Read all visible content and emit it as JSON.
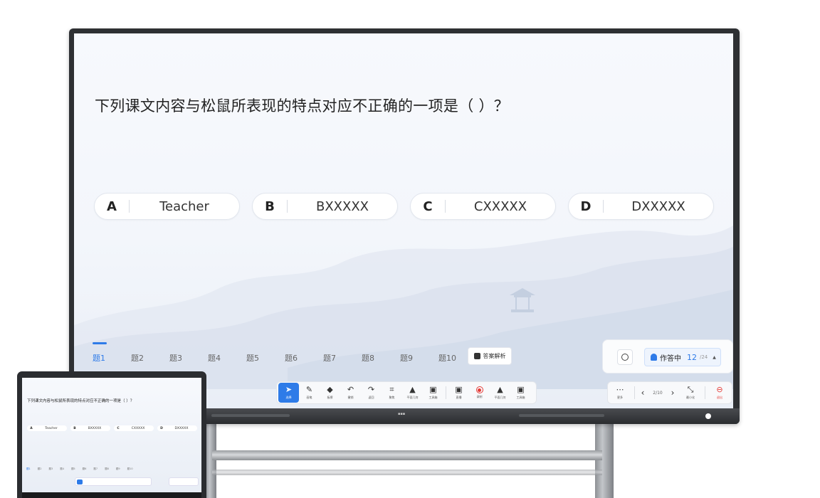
{
  "question": {
    "text": "下列课文内容与松鼠所表现的特点对应不正确的一项是（ ）？"
  },
  "options": [
    {
      "letter": "A",
      "text": "Teacher"
    },
    {
      "letter": "B",
      "text": "BXXXXX"
    },
    {
      "letter": "C",
      "text": "CXXXXX"
    },
    {
      "letter": "D",
      "text": "DXXXXX"
    }
  ],
  "tabs": [
    "题1",
    "题2",
    "题3",
    "题4",
    "题5",
    "题6",
    "题7",
    "题8",
    "题9",
    "题10"
  ],
  "active_tab": "题1",
  "analysis_label": "答案解析",
  "status": {
    "label": "作答中",
    "count": "12",
    "total": "/24"
  },
  "toolbar": [
    {
      "label": "选择",
      "icon": "cursor-icon",
      "glyph": "➤"
    },
    {
      "label": "画笔",
      "icon": "pen-icon",
      "glyph": "✎"
    },
    {
      "label": "板擦",
      "icon": "eraser-icon",
      "glyph": "◆"
    },
    {
      "label": "撤销",
      "icon": "undo-icon",
      "glyph": "↶"
    },
    {
      "label": "返回",
      "icon": "redo-icon",
      "glyph": "↷"
    },
    {
      "label": "聚焦",
      "icon": "focus-icon",
      "glyph": "⌗"
    },
    {
      "label": "平面几何",
      "icon": "geometry-icon",
      "glyph": "▲"
    },
    {
      "label": "工具箱",
      "icon": "toolbox-icon",
      "glyph": "▣"
    },
    {
      "label": "直播",
      "icon": "live-icon",
      "glyph": "▣"
    },
    {
      "label": "录制",
      "icon": "record-icon",
      "glyph": ""
    },
    {
      "label": "平面几何",
      "icon": "geometry-icon",
      "glyph": "▲"
    },
    {
      "label": "工具箱",
      "icon": "toolbox-icon",
      "glyph": "▣"
    }
  ],
  "pager": {
    "more_label": "更多",
    "page": "2/10",
    "minimize_label": "最小化",
    "exit_label": "退出"
  },
  "colors": {
    "accent": "#2e7be8",
    "danger": "#e53935"
  }
}
